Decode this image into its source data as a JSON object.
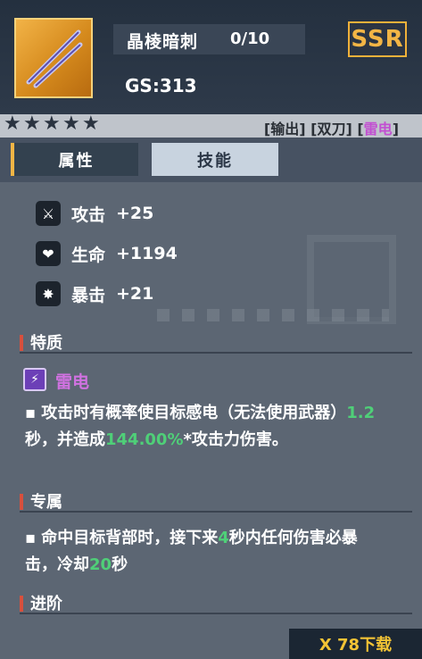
{
  "item": {
    "name": "晶棱暗刺",
    "level": "0/10",
    "rarity": "SSR",
    "gs": "GS:313",
    "stars": 5
  },
  "tags": {
    "output": "[输出]",
    "dual_blade": "[双刀]",
    "element_open": "[",
    "element": "雷电",
    "element_close": "]"
  },
  "tabs": {
    "attributes": "属性",
    "skills": "技能"
  },
  "stats": [
    {
      "label": "攻击",
      "value": "+25",
      "icon": "blade-icon"
    },
    {
      "label": "生命",
      "value": "+1194",
      "icon": "heart-icon"
    },
    {
      "label": "暴击",
      "value": "+21",
      "icon": "burst-icon"
    }
  ],
  "sections": {
    "trait": "特质",
    "exclusive": "专属",
    "advance": "进阶"
  },
  "trait": {
    "name": "雷电",
    "icon": "lightning-icon",
    "desc_part1": "攻击时有概率使目标感电（无法使用武器）",
    "desc_hl1": "1.2",
    "desc_part2": "秒，并造成",
    "desc_hl2": "144.00%",
    "desc_part3": "*攻击力伤害。"
  },
  "exclusive": {
    "part1": "命中目标背部时，接下来",
    "hl1": "4",
    "part2": "秒内任何伤害必暴击，冷却",
    "hl2": "20",
    "part3": "秒"
  },
  "watermark_text": "X 78下载",
  "colors": {
    "accent_gold": "#f3b545",
    "element_purple": "#c24fd1",
    "highlight_green": "#4fcf78"
  }
}
